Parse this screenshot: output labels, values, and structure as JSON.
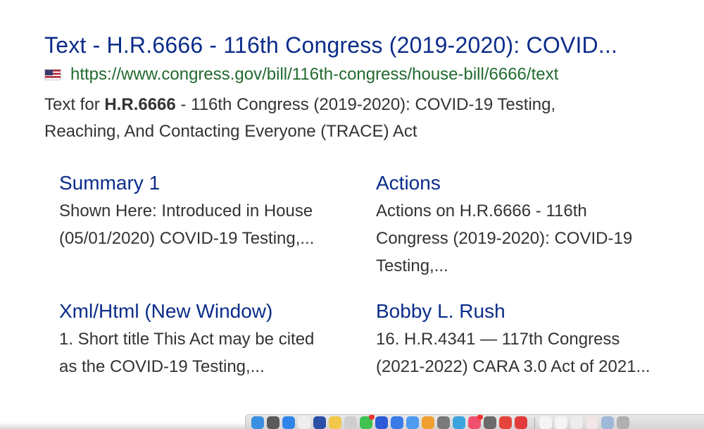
{
  "result": {
    "title": "Text - H.R.6666 - 116th Congress (2019-2020): COVID...",
    "flag_icon": "us-flag-icon",
    "url": "https://www.congress.gov/bill/116th-congress/house-bill/6666/text",
    "snippet_prefix": "Text for ",
    "snippet_bold": "H.R.6666",
    "snippet_suffix": " - 116th Congress (2019-2020): COVID-19 Testing, Reaching, And Contacting Everyone (TRACE) Act"
  },
  "sitelinks": [
    {
      "title": "Summary 1",
      "desc": "Shown Here: Introduced in House (05/01/2020) COVID-19 Testing,..."
    },
    {
      "title": "Actions",
      "desc": "Actions on H.R.6666 - 116th Congress (2019-2020): COVID-19 Testing,..."
    },
    {
      "title": "Xml/Html (New Window)",
      "desc": "1. Short title This Act may be cited as the COVID-19 Testing,..."
    },
    {
      "title": "Bobby L. Rush",
      "desc": "16. H.R.4341 — 117th Congress (2021-2022) CARA 3.0 Act of 2021..."
    }
  ],
  "dock": {
    "icons": [
      {
        "name": "finder-icon",
        "color": "#3b8fe0"
      },
      {
        "name": "launchpad-icon",
        "color": "#5a5a5a"
      },
      {
        "name": "safari-icon",
        "color": "#2f86e8"
      },
      {
        "name": "blank-icon",
        "color": "#eeeeee"
      },
      {
        "name": "notes-icon",
        "color": "#2b4fa6"
      },
      {
        "name": "stickies-icon",
        "color": "#f2c84b"
      },
      {
        "name": "contacts-icon",
        "color": "#cfcfcf"
      },
      {
        "name": "messages-icon",
        "color": "#3fc24f",
        "badge": true
      },
      {
        "name": "zoom-icon",
        "color": "#2d5bd6"
      },
      {
        "name": "messenger-icon",
        "color": "#3a7be8"
      },
      {
        "name": "mail-icon",
        "color": "#4e9bf0"
      },
      {
        "name": "photos-icon",
        "color": "#f0a030"
      },
      {
        "name": "system-preferences-icon",
        "color": "#7a7a7a"
      },
      {
        "name": "telegram-icon",
        "color": "#3ba3de"
      },
      {
        "name": "itunes-icon",
        "color": "#f0506e",
        "badge": true
      },
      {
        "name": "app-store-icon",
        "color": "#6b6b6b"
      },
      {
        "name": "chrome-icon",
        "color": "#e5443a"
      },
      {
        "name": "calendar-icon",
        "color": "#e33b3b"
      }
    ],
    "trailing_icons": [
      {
        "name": "document-icon",
        "color": "#f4f4f4"
      },
      {
        "name": "document-icon",
        "color": "#f4f4f4"
      },
      {
        "name": "document-icon",
        "color": "#ececec"
      },
      {
        "name": "document-icon",
        "color": "#f0e6e6"
      },
      {
        "name": "folder-icon",
        "color": "#9fb8d8"
      },
      {
        "name": "trash-icon",
        "color": "#b0b0b0"
      }
    ]
  }
}
